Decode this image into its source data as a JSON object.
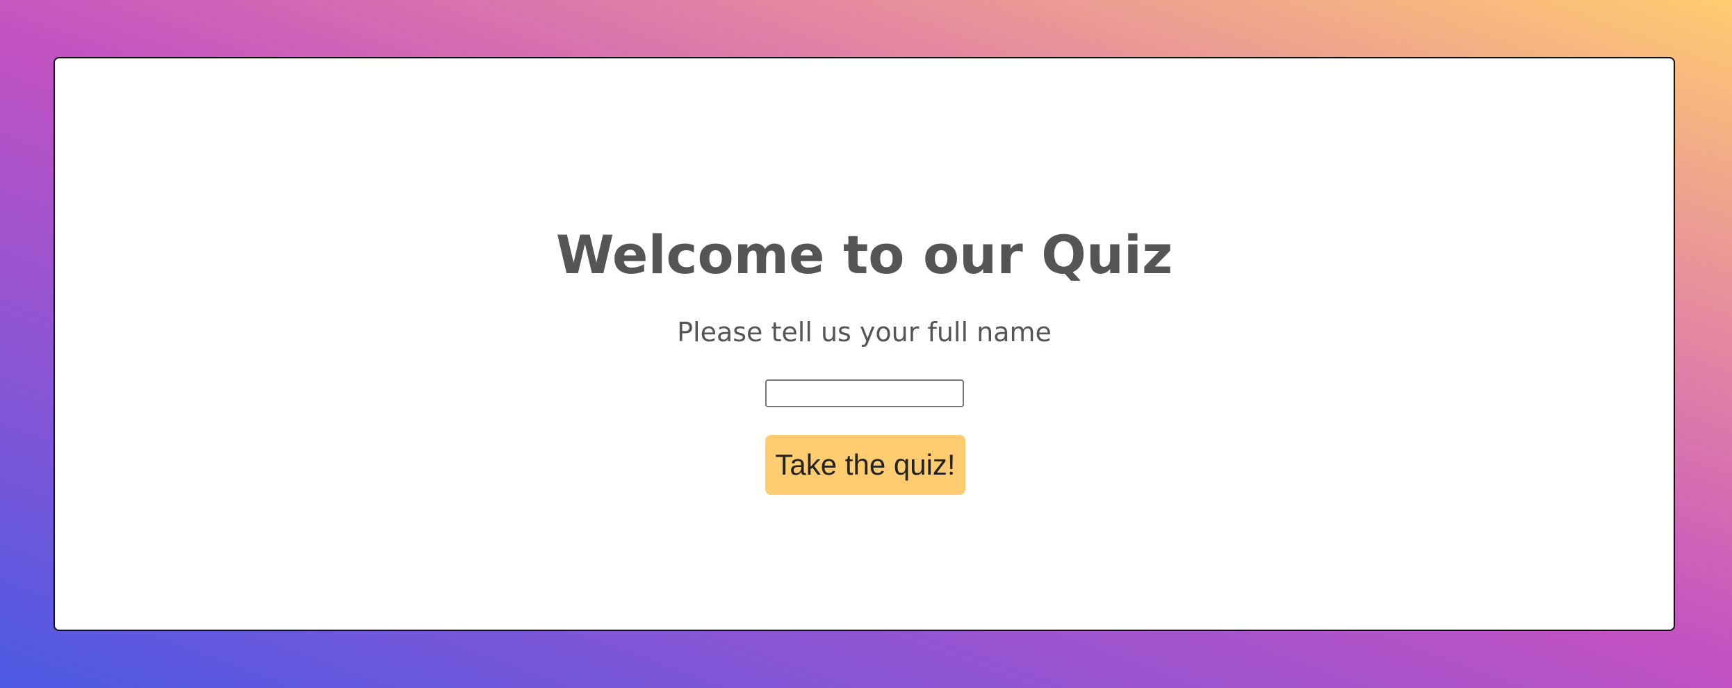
{
  "colors": {
    "background_gradient": [
      "#4b5ae4",
      "#c352c2",
      "#ffcc70"
    ],
    "card": "#ffffff",
    "title_text": "#555555",
    "button": "#ffcc70"
  },
  "quiz": {
    "title": "Welcome to our Quiz",
    "prompt": "Please tell us your full name",
    "name_input_value": "",
    "start_button_label": "Take the quiz!"
  }
}
